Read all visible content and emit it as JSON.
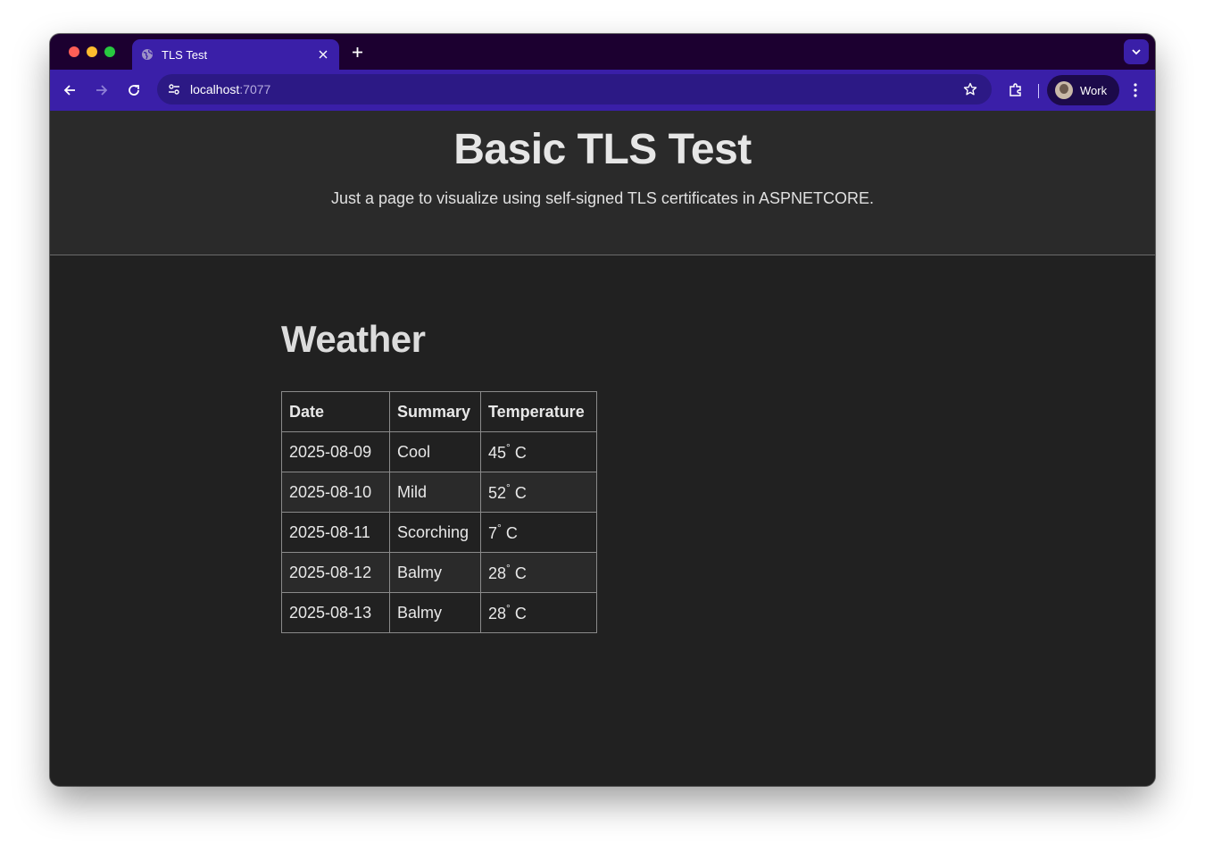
{
  "browser": {
    "tab_title": "TLS Test",
    "url_host": "localhost",
    "url_port": ":7077",
    "profile_label": "Work",
    "colors": {
      "tabstrip": "#1c0030",
      "toolbar": "#3a1fa8",
      "omnibox": "#2c1985"
    }
  },
  "hero": {
    "title": "Basic TLS Test",
    "subtitle": "Just a page to visualize using self-signed TLS certificates in ASPNETCORE."
  },
  "weather": {
    "title": "Weather",
    "columns": [
      "Date",
      "Summary",
      "Temperature"
    ],
    "rows": [
      {
        "date": "2025-08-09",
        "summary": "Cool",
        "temp": "45",
        "unit": "C"
      },
      {
        "date": "2025-08-10",
        "summary": "Mild",
        "temp": "52",
        "unit": "C"
      },
      {
        "date": "2025-08-11",
        "summary": "Scorching",
        "temp": "7",
        "unit": "C"
      },
      {
        "date": "2025-08-12",
        "summary": "Balmy",
        "temp": "28",
        "unit": "C"
      },
      {
        "date": "2025-08-13",
        "summary": "Balmy",
        "temp": "28",
        "unit": "C"
      }
    ]
  }
}
